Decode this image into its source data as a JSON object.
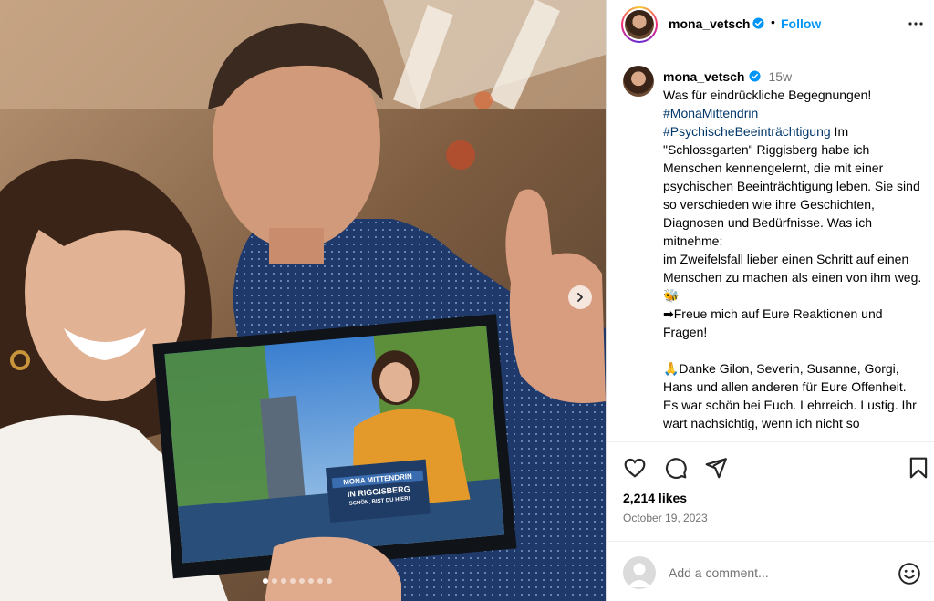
{
  "post": {
    "username": "mona_vetsch",
    "follow_label": "Follow",
    "separator": "•",
    "verified_color": "#0095f6",
    "accent_color": "#0095f6",
    "hashtag_color": "#00376b"
  },
  "caption": {
    "username": "mona_vetsch",
    "time": "15w",
    "intro": "Was für eindrückliche Begegnungen!",
    "hashtag_1": "#MonaMittendrin",
    "hashtag_2": "#PsychischeBeeinträchtigung",
    "body_1": " Im \"Schlossgarten\" Riggisberg habe ich Menschen kennengelernt, die mit einer psychischen Beeinträchtigung leben. Sie sind so verschieden wie ihre Geschichten, Diagnosen und Bedürfnisse. Was ich mitnehme:",
    "body_2": "im Zweifelsfall lieber einen Schritt auf einen Menschen zu machen als einen von ihm weg. 🐝",
    "body_3": "➡Freue mich auf Eure Reaktionen und Fragen!",
    "body_4": "🙏Danke Gilon, Severin, Susanne, Gorgi, Hans und allen anderen für Eure Offenheit.",
    "body_5": "Es war schön bei Euch. Lehrreich. Lustig. Ihr wart nachsichtig, wenn ich nicht so"
  },
  "stats": {
    "likes": "2,214 likes",
    "date": "October 19, 2023"
  },
  "comment": {
    "placeholder": "Add a comment..."
  },
  "photo_card": {
    "title": "MONA MITTENDRIN",
    "subtitle": "IN RIGGISBERG",
    "tagline": "SCHÖN, BIST DU HIER!"
  },
  "carousel": {
    "slide_count": 8,
    "active_index": 0
  },
  "icons": {
    "like": "heart-icon",
    "comment": "comment-icon",
    "share": "share-icon",
    "save": "bookmark-icon",
    "more": "more-options-icon",
    "emoji": "emoji-icon",
    "next": "chevron-right-icon"
  }
}
